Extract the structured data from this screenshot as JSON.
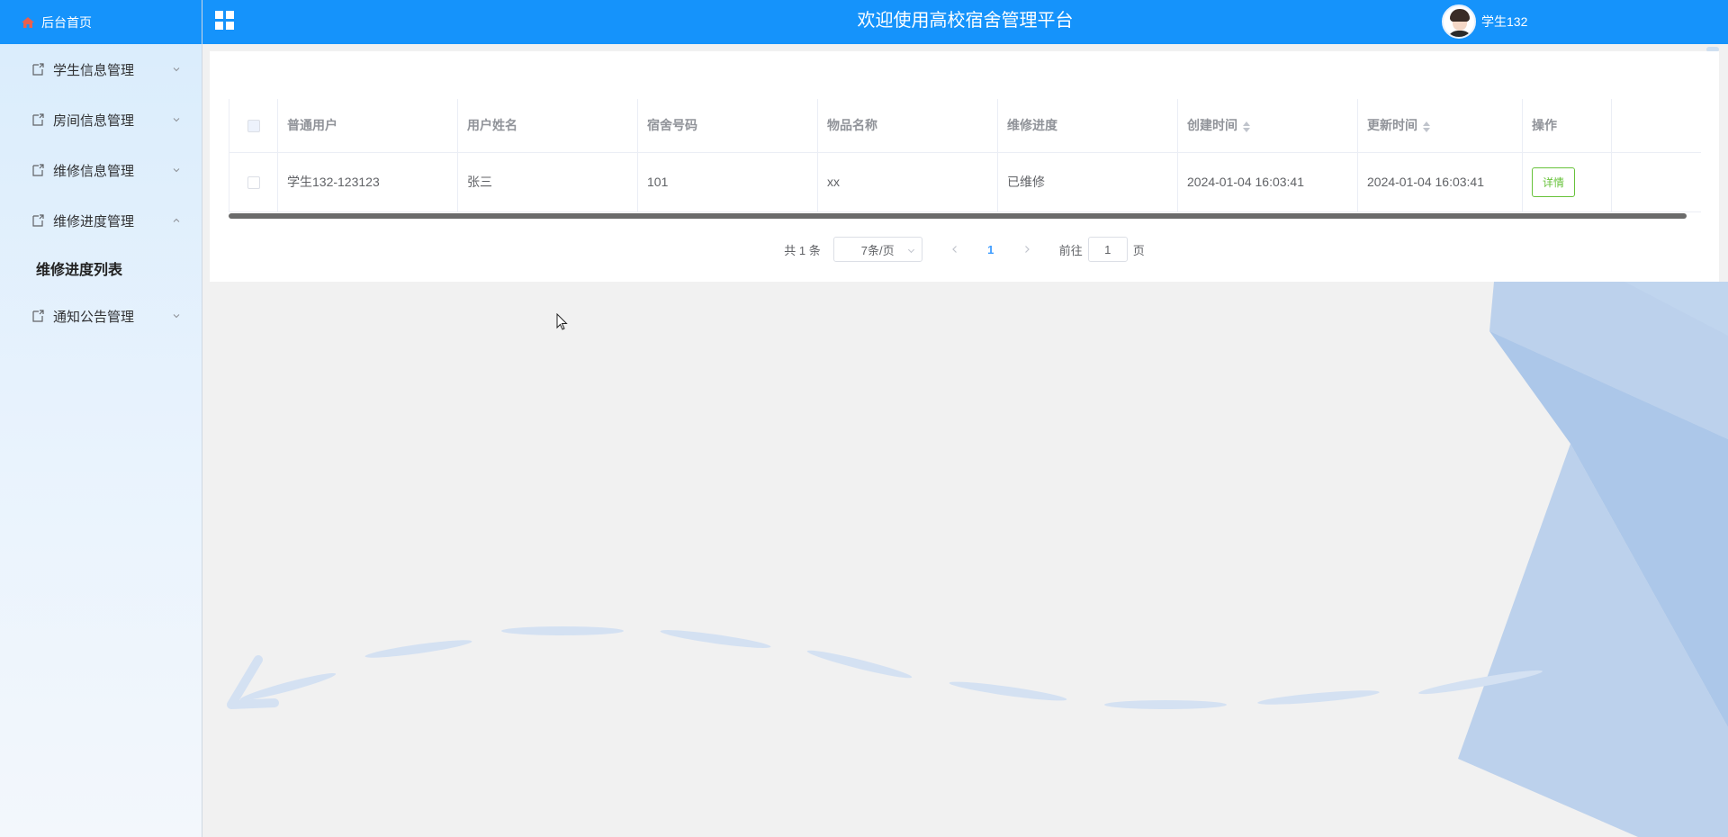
{
  "sidebar": {
    "home_label": "后台首页",
    "items": [
      {
        "label": "学生信息管理",
        "expanded": false
      },
      {
        "label": "房间信息管理",
        "expanded": false
      },
      {
        "label": "维修信息管理",
        "expanded": false
      },
      {
        "label": "维修进度管理",
        "expanded": true,
        "children": [
          "维修进度列表"
        ]
      },
      {
        "label": "通知公告管理",
        "expanded": false
      }
    ]
  },
  "header": {
    "title": "欢迎使用高校宿舍管理平台",
    "username": "学生132",
    "menu_icon": "grid-icon"
  },
  "table": {
    "columns": [
      "普通用户",
      "用户姓名",
      "宿舍号码",
      "物品名称",
      "维修进度",
      "创建时间",
      "更新时间",
      "操作"
    ],
    "rows": [
      {
        "cells": [
          "学生132-123123",
          "张三",
          "101",
          "xx",
          "已维修",
          "2024-01-04 16:03:41",
          "2024-01-04 16:03:41"
        ],
        "action": "详情"
      }
    ]
  },
  "pagination": {
    "total": "共 1 条",
    "page_size": "7条/页",
    "current_page": "1",
    "goto_prefix": "前往",
    "goto_value": "1",
    "goto_suffix": "页"
  },
  "colors": {
    "primary": "#1593fb",
    "link": "#409eff",
    "success": "#67c23a"
  }
}
